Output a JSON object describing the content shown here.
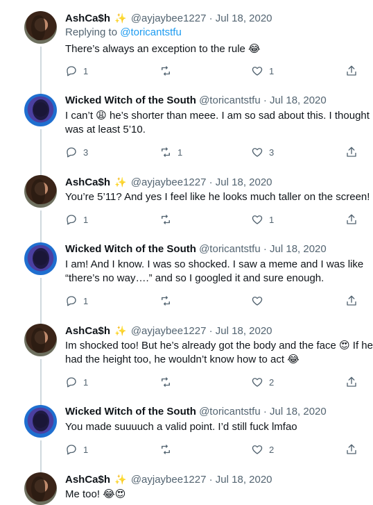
{
  "thread": {
    "tweets": [
      {
        "display_name": "AshCa$h",
        "verified_sparkle": "✨",
        "handle": "@ayjaybee1227",
        "separator": "·",
        "date": "Jul 18, 2020",
        "replying_to_prefix": "Replying to",
        "replying_to_handle": "@toricantstfu",
        "text": "There’s always an exception to the rule 😂",
        "reply_count": "1",
        "retweet_count": "",
        "like_count": "1"
      },
      {
        "display_name": "Wicked Witch of the South",
        "handle": "@toricantstfu",
        "separator": "·",
        "date": "Jul 18, 2020",
        "text": "I can’t 😩 he’s shorter than meee. I am so sad about this. I thought he was at least 5’10.",
        "reply_count": "3",
        "retweet_count": "1",
        "like_count": "3"
      },
      {
        "display_name": "AshCa$h",
        "verified_sparkle": "✨",
        "handle": "@ayjaybee1227",
        "separator": "·",
        "date": "Jul 18, 2020",
        "text": "You’re 5’11? And yes I feel like he looks much taller on the screen!",
        "reply_count": "1",
        "retweet_count": "",
        "like_count": "1"
      },
      {
        "display_name": "Wicked Witch of the South",
        "handle": "@toricantstfu",
        "separator": "·",
        "date": "Jul 18, 2020",
        "text": "I am! And I know. I was so shocked. I saw a meme and I was like “there’s no way….” and so I googled it and sure enough.",
        "reply_count": "1",
        "retweet_count": "",
        "like_count": ""
      },
      {
        "display_name": "AshCa$h",
        "verified_sparkle": "✨",
        "handle": "@ayjaybee1227",
        "separator": "·",
        "date": "Jul 18, 2020",
        "text": "Im shocked too! But he’s already got the body and the face 😍 If he had the height too, he wouldn’t know how to act 😂",
        "reply_count": "1",
        "retweet_count": "",
        "like_count": "2"
      },
      {
        "display_name": "Wicked Witch of the South",
        "handle": "@toricantstfu",
        "separator": "·",
        "date": "Jul 18, 2020",
        "text": "You made suuuuch a valid point. I’d still fuck lmfao",
        "reply_count": "1",
        "retweet_count": "",
        "like_count": "2"
      },
      {
        "display_name": "AshCa$h",
        "verified_sparkle": "✨",
        "handle": "@ayjaybee1227",
        "separator": "·",
        "date": "Jul 18, 2020",
        "text": "Me too! 😂😍"
      }
    ]
  },
  "icons": {
    "reply": "reply-icon",
    "retweet": "retweet-icon",
    "like": "heart-icon",
    "share": "share-icon"
  },
  "colors": {
    "link": "#1d9bf0",
    "secondary_text": "#536471",
    "thread_line": "#cfd9de",
    "sparkle": "#f4b400"
  }
}
